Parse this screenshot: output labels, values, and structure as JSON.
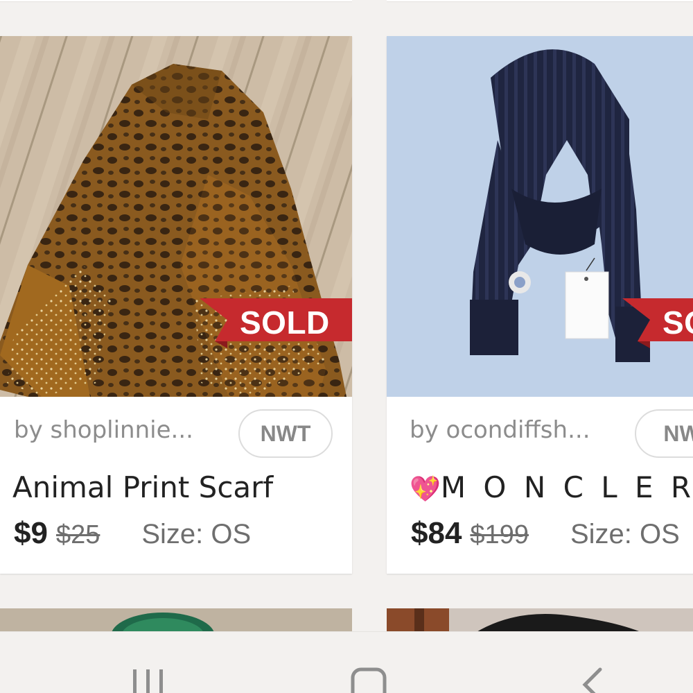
{
  "listings": [
    {
      "seller": "by shoplinnie...",
      "badge": "NWT",
      "title": "Animal Print Scarf",
      "price": "$9",
      "original_price": "$25",
      "size": "Size: OS",
      "status": "SOLD",
      "image": "leopard-print-scarf-photo"
    },
    {
      "seller": "by ocondiffsh...",
      "badge": "NW",
      "title_heart_left": "💖",
      "title": "M O N C L E R",
      "title_heart_right": "💖",
      "price": "$84",
      "original_price": "$199",
      "size": "Size: OS",
      "status": "SOL",
      "image": "navy-knit-scarf-photo"
    }
  ],
  "colors": {
    "background": "#f3f1ef",
    "sold_ribbon": "#c62a2e",
    "price_text": "#222222",
    "muted_text": "#8c8c8c"
  },
  "navigation": {
    "recent_apps": "recent-apps-icon",
    "home": "home-icon",
    "back": "back-icon"
  }
}
